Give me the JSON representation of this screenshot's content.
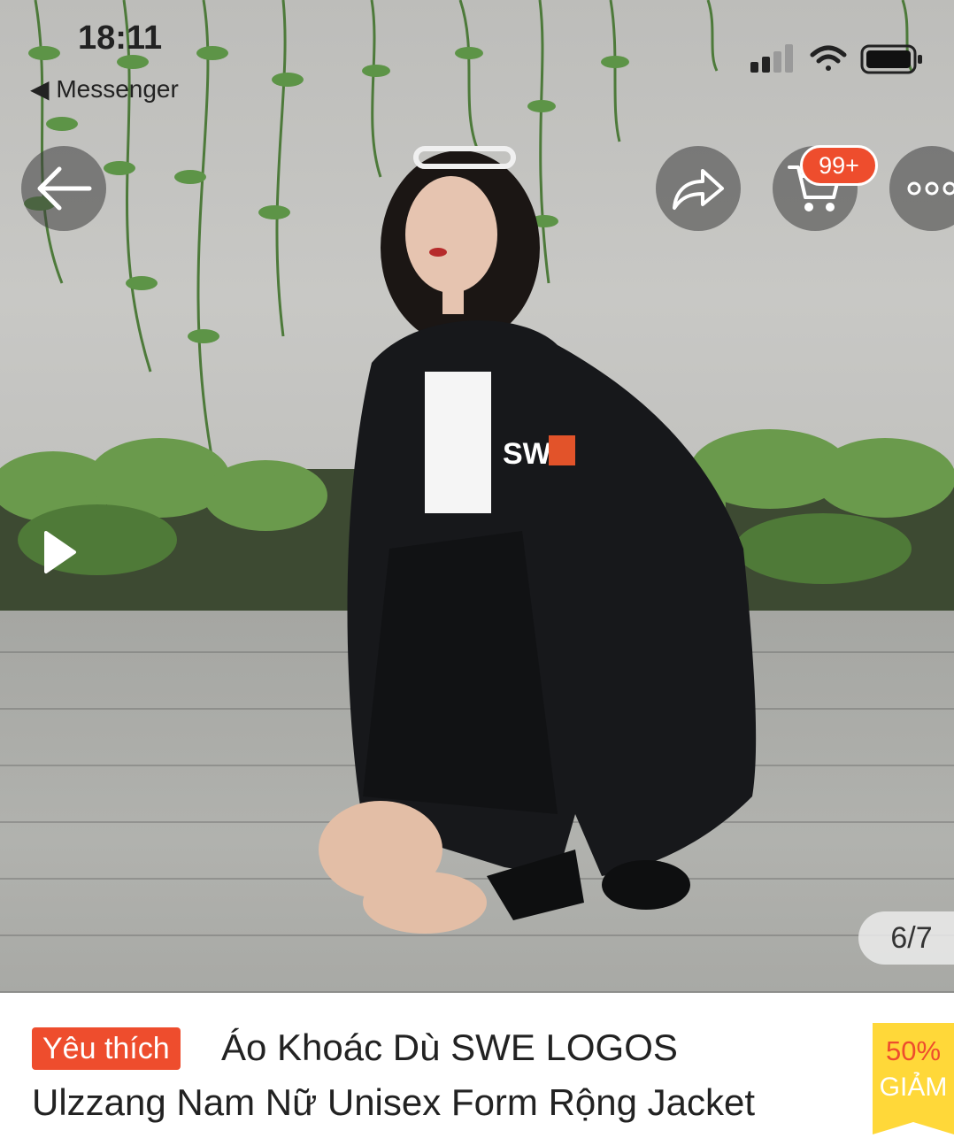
{
  "status_bar": {
    "time": "18:11",
    "back_app": "◀ Messenger"
  },
  "toolbar": {
    "cart_badge": "99+"
  },
  "gallery": {
    "counter": "6/7"
  },
  "product": {
    "badge": "Yêu thích",
    "title_line1": "Áo Khoác Dù SWE LOGOS",
    "title_line2": "Ulzzang Nam Nữ Unisex Form Rộng Jacket"
  },
  "discount": {
    "percent": "50%",
    "label": "GIẢM"
  },
  "colors": {
    "accent": "#ee4d2d",
    "discount_bg": "#ffd839"
  },
  "icons": [
    "back-arrow-icon",
    "share-icon",
    "cart-icon",
    "more-icon",
    "play-icon",
    "signal-icon",
    "wifi-icon",
    "battery-icon"
  ]
}
